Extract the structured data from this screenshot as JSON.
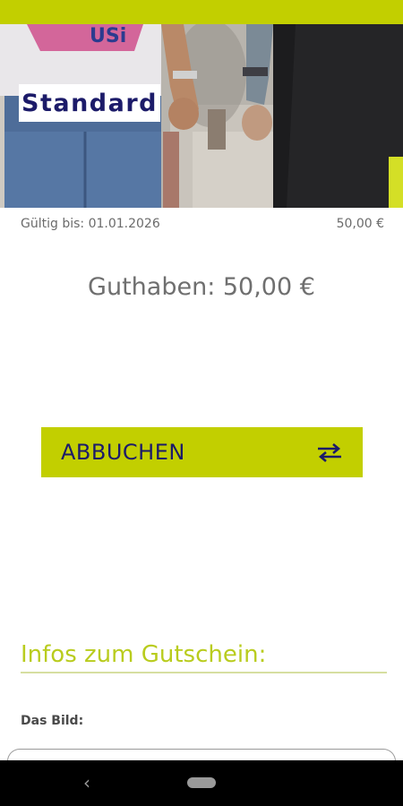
{
  "voucher": {
    "badge": "Standard",
    "valid_until": "Gültig bis: 01.01.2026",
    "value": "50,00 €",
    "balance": "Guthaben: 50,00 €"
  },
  "actions": {
    "book_label": "ABBUCHEN",
    "book_icon": "swap-horizontal-icon"
  },
  "info": {
    "title": "Infos zum Gutschein:",
    "image_label": "Das Bild:"
  },
  "navigation": {
    "back_icon": "back-chevron-icon",
    "back_glyph": "‹",
    "home_icon": "home-pill-icon"
  },
  "colors": {
    "accent": "#c2cf00",
    "accent_text": "#b9cc1e",
    "brand_navy": "#1c1b69",
    "text_gray": "#6f6f6f"
  }
}
